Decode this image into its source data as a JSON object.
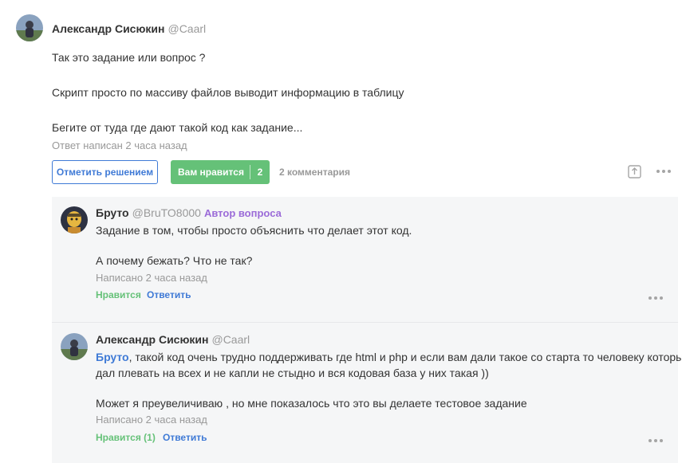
{
  "answer": {
    "author_name": "Александр Сисюкин",
    "author_nick": "@Caarl",
    "lines": [
      "Так это задание или вопрос ?",
      "Скрипт просто по массиву файлов выводит информацию в таблицу",
      "Бегите от туда где дают такой код как задание..."
    ],
    "meta": "Ответ написан 2 часа назад",
    "mark_solution_label": "Отметить решением",
    "like_label": "Вам нравится",
    "like_count": "2",
    "comments_label": "2 комментария"
  },
  "comments": [
    {
      "author_name": "Бруто",
      "author_nick": "@BruTO8000",
      "badge": "Автор вопроса",
      "lines": [
        "Задание в том, чтобы просто объяснить что делает этот код.",
        "А почему бежать? Что не так?"
      ],
      "meta": "Написано 2 часа назад",
      "like_label": "Нравится",
      "reply_label": "Ответить"
    },
    {
      "author_name": "Александр Сисюкин",
      "author_nick": "@Caarl",
      "mention": "Бруто",
      "line1_rest": ", такой код очень трудно поддерживать где html и php и если вам дали такое со старта то человеку который",
      "line2": "дал плевать на всех и не капли не стыдно и вся кодовая база у них такая ))",
      "line3": "Может я преувеличиваю , но мне показалось что это вы делаете тестовое задание",
      "meta": "Написано 2 часа назад",
      "like_label": "Нравится (1)",
      "reply_label": "Ответить"
    }
  ],
  "icons": {
    "share": "share-icon",
    "more": "more-dots-icon"
  },
  "colors": {
    "accent_blue": "#3f7ad6",
    "like_green": "#65c178",
    "asker_purple": "#9b6bd8",
    "muted": "#999999",
    "comments_bg": "#f5f6f7"
  }
}
